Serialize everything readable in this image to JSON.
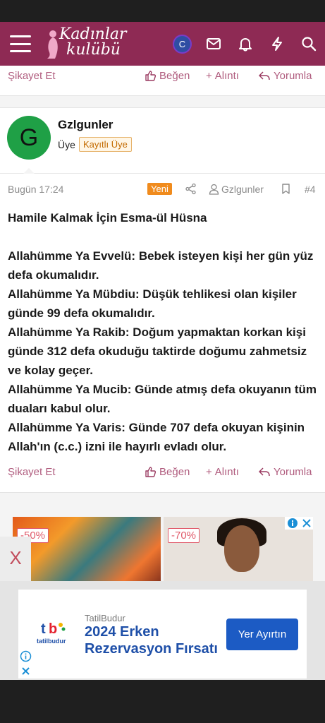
{
  "header": {
    "logo_line1": "Kadınlar",
    "logo_line2": "kulübü",
    "avatar_letter": "C",
    "icons": [
      "menu-icon",
      "mail-icon",
      "bell-icon",
      "bolt-icon",
      "search-icon"
    ]
  },
  "prev_post_actions": {
    "report": "Şikayet Et",
    "like": "Beğen",
    "quote": "Alıntı",
    "reply": "Yorumla"
  },
  "user": {
    "avatar_letter": "G",
    "name": "Gzlgunler",
    "role": "Üye",
    "badge": "Kayıtlı Üye"
  },
  "post": {
    "date": "Bugün 17:24",
    "new_label": "Yeni",
    "author": "Gzlgunler",
    "number": "#4",
    "title": "Hamile Kalmak İçin Esma-ül Hüsna",
    "paragraphs": [
      "Allahümme Ya Evvelü: Bebek isteyen kişi her gün yüz defa okumalıdır.",
      "Allahümme Ya Mübdiu: Düşük tehlikesi olan kişiler günde 99 defa okumalıdır.",
      "Allahümme Ya Rakib: Doğum yapmaktan korkan kişi günde 312 defa okuduğu taktirde doğumu zahmetsiz ve kolay geçer.",
      "Allahümme Ya Mucib: Günde atmış defa okuyanın tüm duaları kabul olur.",
      "Allahümme Ya Varis: Günde 707 defa okuyan kişinin Allah'ın (c.c.) izni ile hayırlı evladı olur."
    ]
  },
  "post_actions": {
    "report": "Şikayet Et",
    "like": "Beğen",
    "quote": "Alıntı",
    "reply": "Yorumla"
  },
  "ad_products": {
    "discount_left": "-50%",
    "discount_right": "-70%",
    "close_side": "X"
  },
  "banner": {
    "logo_text": "tatilbudur",
    "brand": "TatilBudur",
    "title_line1": "2024 Erken",
    "title_line2": "Rezervasyon Fırsatı",
    "cta": "Yer Ayırtın"
  },
  "colors": {
    "nav": "#8e2a54",
    "accent": "#9b3c62",
    "new_badge": "#f08b1d",
    "cta": "#1c5bc4"
  }
}
